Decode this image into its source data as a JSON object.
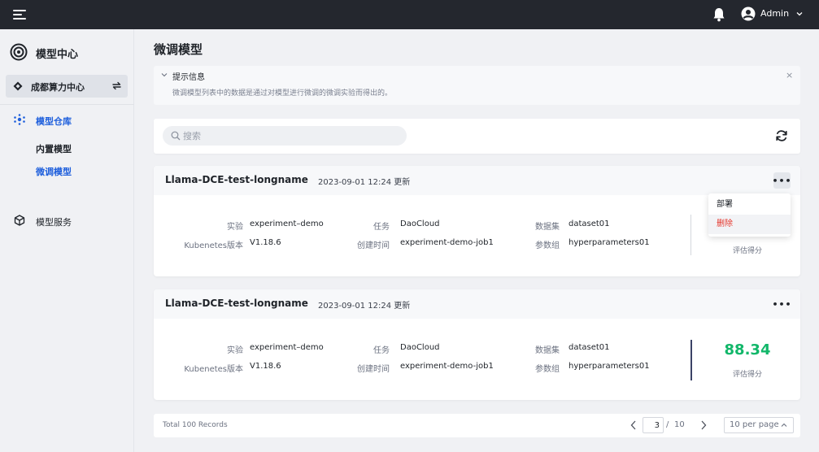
{
  "topbar": {
    "user_name": "Admin"
  },
  "sidebar": {
    "title": "模型中心",
    "cluster": "成都算力中心",
    "groups": [
      {
        "label": "模型仓库",
        "items": [
          "内置模型",
          "微调模型"
        ]
      },
      {
        "label": "模型服务"
      }
    ]
  },
  "page": {
    "title": "微调模型",
    "notice_title": "提示信息",
    "notice_text": "微调模型列表中的数据是通过对模型进行微调的微调实验而得出的。",
    "notice_close": "×",
    "search_placeholder": "搜索"
  },
  "cards": [
    {
      "name": "Llama-DCE-test-longname",
      "time": "2023-09-01 12:24 更新",
      "more": "•••",
      "labels": [
        "实验",
        "Kubenetes版本",
        "任务",
        "创建时间",
        "数据集",
        "参数组"
      ],
      "values": [
        "experiment–demo",
        "V1.18.6",
        "DaoCloud",
        "experiment-demo-job1",
        "dataset01",
        "hyperparameters01"
      ],
      "score": "",
      "score_label": "评估得分"
    },
    {
      "name": "Llama-DCE-test-longname",
      "time": "2023-09-01 12:24 更新",
      "more": "•••",
      "labels": [
        "实验",
        "Kubenetes版本",
        "任务",
        "创建时间",
        "数据集",
        "参数组"
      ],
      "values": [
        "experiment–demo",
        "V1.18.6",
        "DaoCloud",
        "experiment-demo-job1",
        "dataset01",
        "hyperparameters01"
      ],
      "score": "88.34",
      "score_label": "评估得分"
    }
  ],
  "dropdown": {
    "deploy": "部署",
    "delete": "删除"
  },
  "pagination": {
    "total": "Total 100 Records",
    "current": "3",
    "slash": "/",
    "pages": "10",
    "per_page": "10 per page"
  },
  "colors": {
    "accent": "#1e5fdc",
    "score": "#12b76a",
    "danger": "#e5352b"
  }
}
